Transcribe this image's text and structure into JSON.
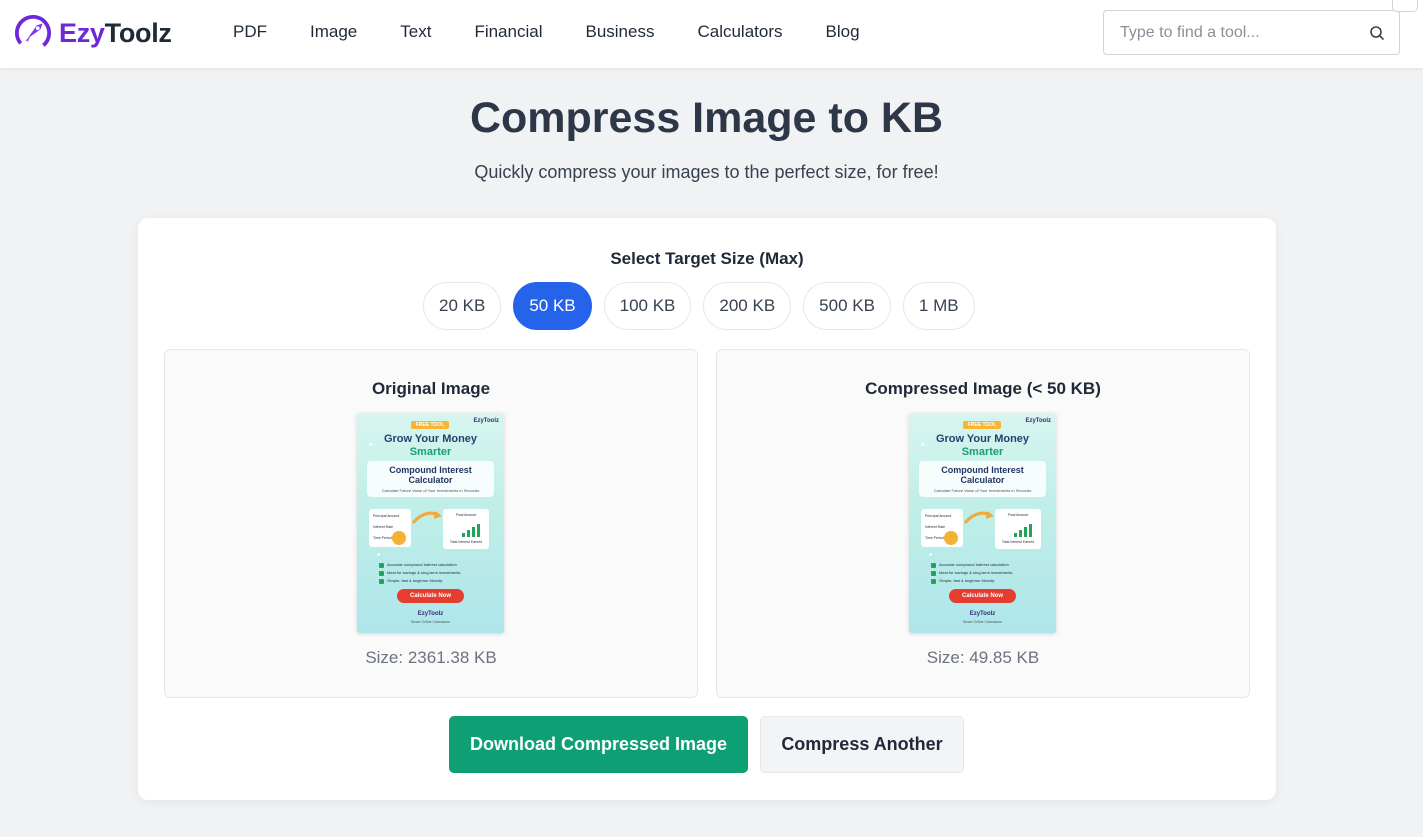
{
  "header": {
    "brand_part1": "Ezy",
    "brand_part2": "Toolz",
    "nav": [
      "PDF",
      "Image",
      "Text",
      "Financial",
      "Business",
      "Calculators",
      "Blog"
    ],
    "search_placeholder": "Type to find a tool...",
    "search_icon": "search-icon"
  },
  "hero": {
    "title": "Compress Image to KB",
    "subtitle": "Quickly compress your images to the perfect size, for free!"
  },
  "target": {
    "label": "Select Target Size (Max)",
    "options": [
      "20 KB",
      "50 KB",
      "100 KB",
      "200 KB",
      "500 KB",
      "1 MB"
    ],
    "selected": "50 KB"
  },
  "original": {
    "title": "Original Image",
    "size": "Size: 2361.38 KB"
  },
  "compressed": {
    "title": "Compressed Image (< 50 KB)",
    "size": "Size: 49.85 KB"
  },
  "thumbnail": {
    "free_tag": "FREE TOOL",
    "brand": "EzyToolz",
    "headline1": "Grow Your Money",
    "headline2": "Smarter",
    "box_title1": "Compound Interest",
    "box_title2": "Calculator",
    "box_sub": "Calculate Future Value of Your Investments in Seconds",
    "inputs": [
      "Principal Amount",
      "Interest Rate",
      "Time Period"
    ],
    "output1": "Final Amount",
    "output2": "Total Interest Earned",
    "checks": [
      "Accurate compound interest calculation",
      "Ideal for savings & long-term investments",
      "Simple, fast & beginner friendly"
    ],
    "cta": "Calculate Now",
    "footer_brand": "EzyToolz",
    "footer_tag": "Smart Online Calculators"
  },
  "actions": {
    "download": "Download Compressed Image",
    "another": "Compress Another"
  },
  "colors": {
    "brand_purple": "#6d28d9",
    "selected_blue": "#2563eb",
    "download_green": "#0f9f75"
  }
}
